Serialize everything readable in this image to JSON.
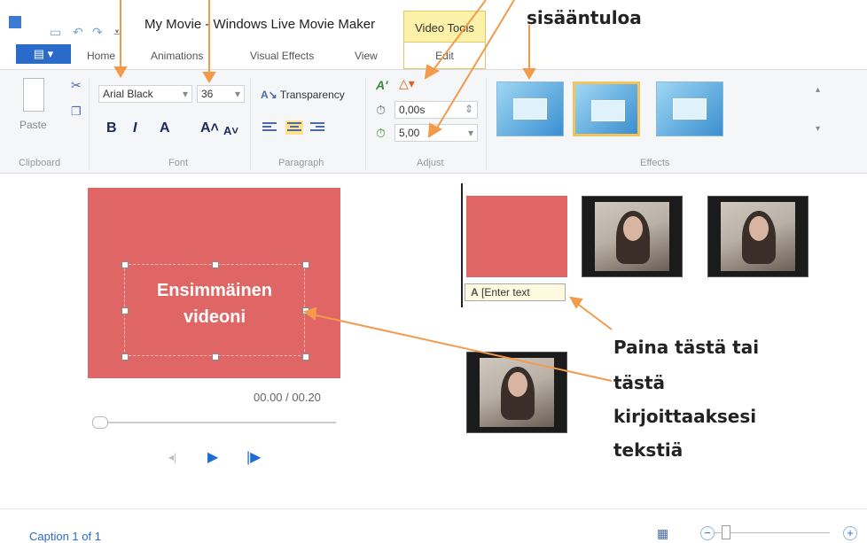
{
  "window": {
    "title": "My Movie - Windows Live Movie Maker"
  },
  "contextual_tab": {
    "group": "Video Tools",
    "tab": "Edit"
  },
  "tabs": [
    "Home",
    "Animations",
    "Visual Effects",
    "View"
  ],
  "ribbon": {
    "clipboard": {
      "paste_label": "Paste",
      "group_label": "Clipboard"
    },
    "font": {
      "family": "Arial Black",
      "size": "36",
      "group_label": "Font",
      "bold": "B",
      "italic": "I",
      "color": "A",
      "grow": "A˄",
      "shrink": "A˅"
    },
    "paragraph": {
      "transparency": "Transparency",
      "group_label": "Paragraph"
    },
    "adjust": {
      "start_time": "0,00s",
      "duration": "5,00",
      "group_label": "Adjust"
    },
    "effects": {
      "group_label": "Effects"
    }
  },
  "preview": {
    "caption_line1": "Ensimmäinen",
    "caption_line2": "videoni",
    "time": "00.00 / 00.20"
  },
  "storyboard": {
    "enter_text": "[Enter text"
  },
  "annotations": {
    "top_right": "sisääntuloa",
    "callout_1": "Paina tästä tai",
    "callout_2": "tästä",
    "callout_3": "kirjoittaaksesi",
    "callout_4": "tekstiä"
  },
  "status": {
    "caption": "Caption 1 of 1"
  },
  "colors": {
    "accent": "#2a6bc9",
    "arrow": "#f39a4b",
    "title_bg": "#e06666",
    "contextual": "#fbf1a8"
  }
}
